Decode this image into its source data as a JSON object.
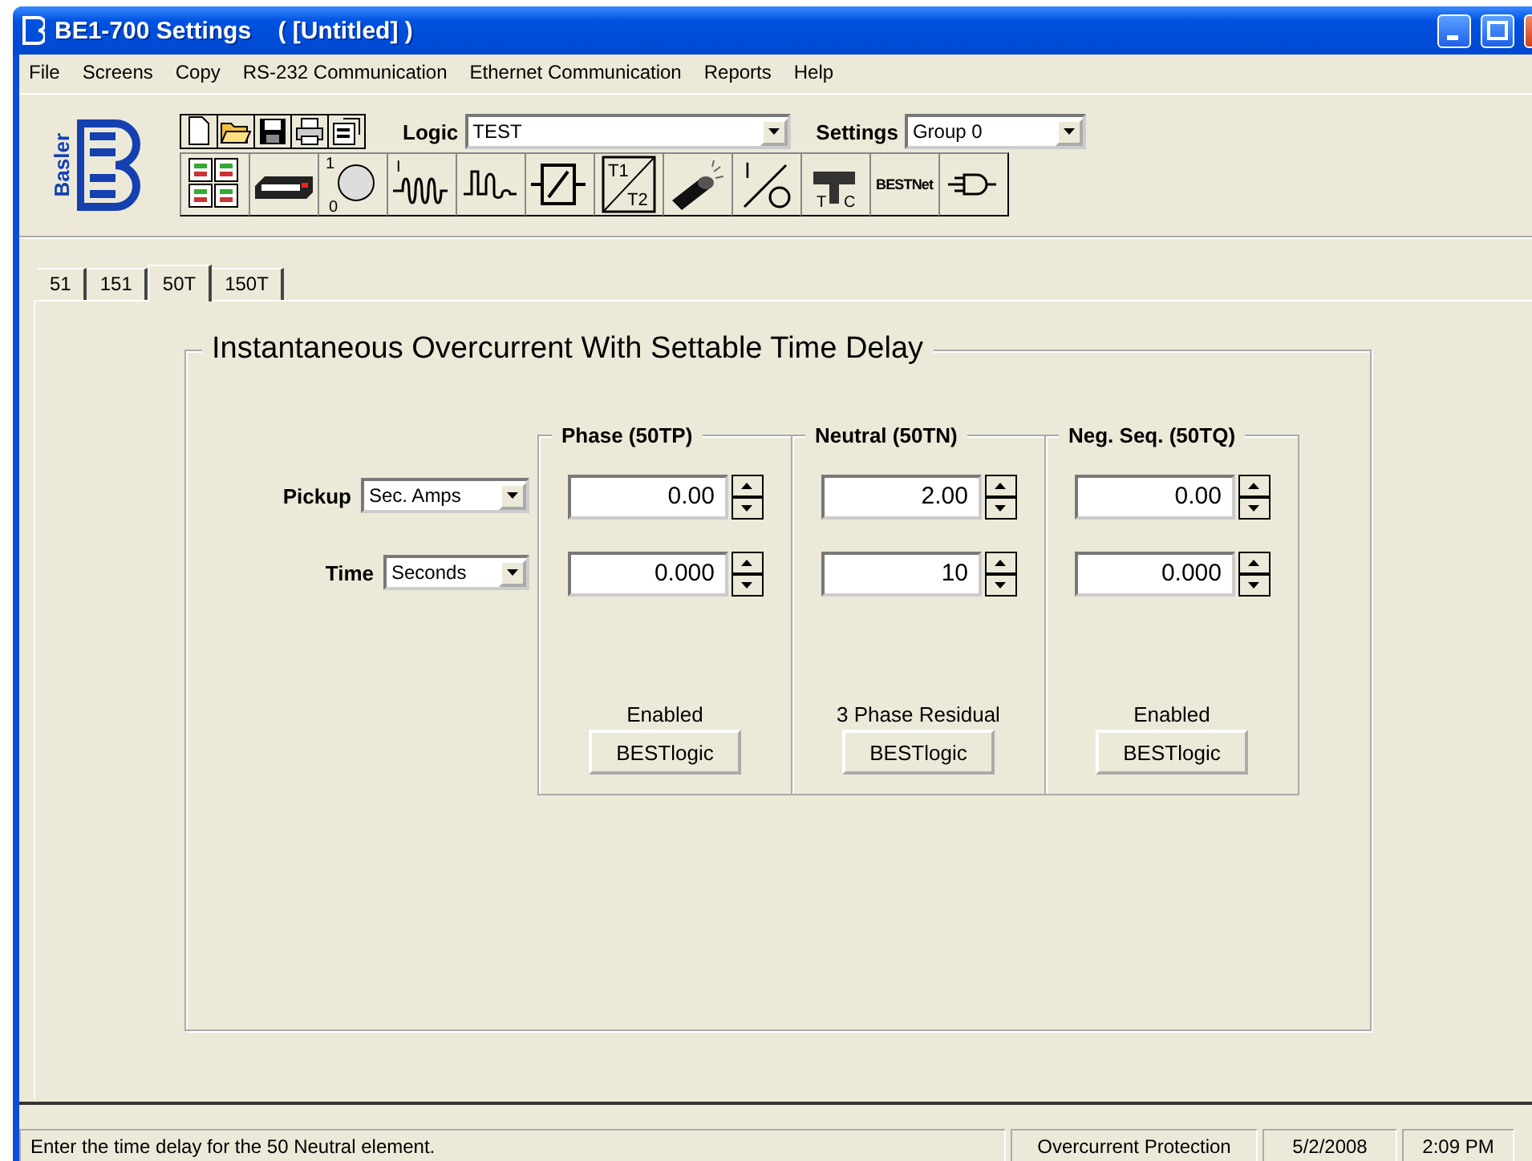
{
  "window": {
    "title": "BE1-700 Settings    ( [Untitled] )"
  },
  "menu": [
    {
      "label": "File"
    },
    {
      "label": "Screens"
    },
    {
      "label": "Copy"
    },
    {
      "label": "RS-232 Communication"
    },
    {
      "label": "Ethernet Communication"
    },
    {
      "label": "Reports"
    },
    {
      "label": "Help"
    }
  ],
  "logo": "Basler",
  "file_tools": [
    {
      "kind": "new"
    },
    {
      "kind": "open"
    },
    {
      "kind": "save"
    },
    {
      "kind": "print"
    },
    {
      "kind": "properties"
    }
  ],
  "logic": {
    "label": "Logic",
    "value": "TEST"
  },
  "settings": {
    "label": "Settings",
    "value": "Group 0"
  },
  "screen_tools": [
    {
      "kind": "grid"
    },
    {
      "kind": "device"
    },
    {
      "kind": "disc",
      "labels": [
        "1",
        "0"
      ]
    },
    {
      "kind": "coil",
      "labels": [
        "I"
      ]
    },
    {
      "kind": "wave"
    },
    {
      "kind": "block"
    },
    {
      "kind": "timer",
      "labels": [
        "T1",
        "T2"
      ]
    },
    {
      "kind": "probe"
    },
    {
      "kind": "switch",
      "labels": [
        "I"
      ]
    },
    {
      "kind": "tc",
      "labels": [
        "T",
        "C"
      ]
    },
    {
      "kind": "text",
      "labels": [
        "BESTNet"
      ]
    },
    {
      "kind": "plug"
    }
  ],
  "tabs": [
    {
      "label": "51",
      "selected": false
    },
    {
      "label": "151",
      "selected": false
    },
    {
      "label": "50T",
      "selected": true
    },
    {
      "label": "150T",
      "selected": false
    }
  ],
  "group": {
    "title": "Instantaneous Overcurrent With Settable Time Delay",
    "pickup": {
      "label": "Pickup",
      "value": "Sec. Amps"
    },
    "time": {
      "label": "Time",
      "value": "Seconds"
    },
    "elements": [
      {
        "title": "Phase (50TP)",
        "pickup": "0.00",
        "time": "0.000",
        "mode": "Enabled",
        "button": "BESTlogic"
      },
      {
        "title": "Neutral (50TN)",
        "pickup": "2.00",
        "time": "10",
        "mode": "3 Phase Residual",
        "button": "BESTlogic"
      },
      {
        "title": "Neg. Seq. (50TQ)",
        "pickup": "0.00",
        "time": "0.000",
        "mode": "Enabled",
        "button": "BESTlogic"
      }
    ]
  },
  "status_bar": {
    "message": "Enter the time delay for the 50 Neutral element.",
    "screen": "Overcurrent Protection",
    "date": "5/2/2008",
    "time": "2:09 PM"
  }
}
